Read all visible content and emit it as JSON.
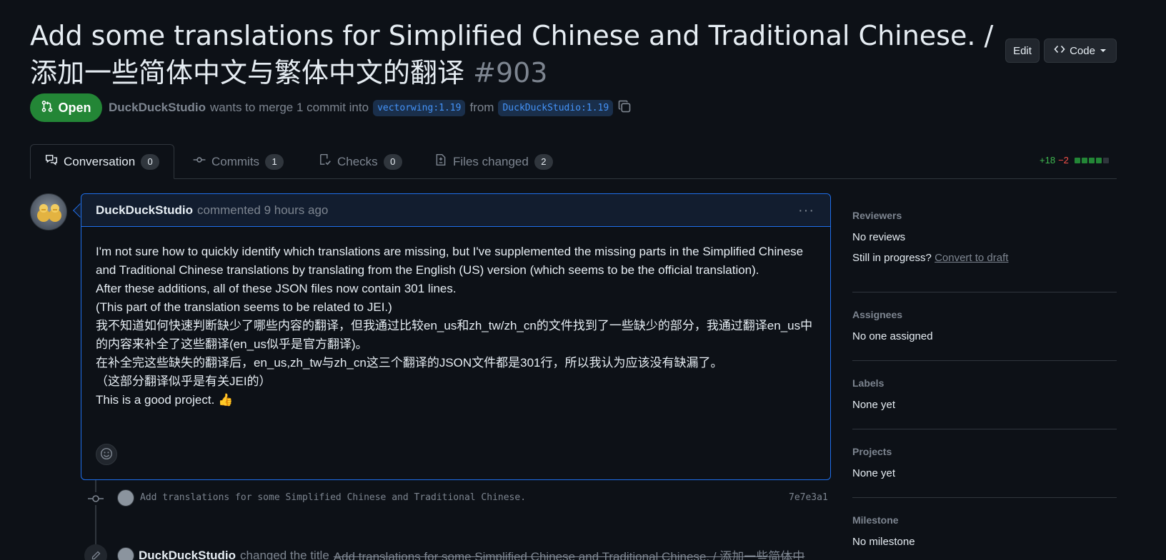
{
  "header": {
    "title": "Add some translations for Simplified Chinese and Traditional Chinese. / 添加一些简体中文与繁体中文的翻译",
    "number": "#903",
    "edit_label": "Edit",
    "code_label": "Code"
  },
  "state": {
    "label": "Open",
    "color": "#238636"
  },
  "meta": {
    "author": "DuckDuckStudio",
    "text": "wants to merge 1 commit into",
    "base_branch": "vectorwing:1.19",
    "from_text": "from",
    "head_branch": "DuckDuckStudio:1.19"
  },
  "tabs": [
    {
      "label": "Conversation",
      "count": "0"
    },
    {
      "label": "Commits",
      "count": "1"
    },
    {
      "label": "Checks",
      "count": "0"
    },
    {
      "label": "Files changed",
      "count": "2"
    }
  ],
  "diffstat": {
    "additions": "+18",
    "deletions": "−2"
  },
  "comment": {
    "author": "DuckDuckStudio",
    "action": "commented 9 hours ago",
    "lines": [
      "I'm not sure how to quickly identify which translations are missing, but I've supplemented the missing parts in the Simplified Chinese and Traditional Chinese translations by translating from the English (US) version (which seems to be the official translation).",
      "After these additions, all of these JSON files now contain 301 lines.",
      "(This part of the translation seems to be related to JEI.)",
      "我不知道如何快速判断缺少了哪些内容的翻译，但我通过比较en_us和zh_tw/zh_cn的文件找到了一些缺少的部分，我通过翻译en_us中的内容来补全了这些翻译(en_us似乎是官方翻译)。",
      "在补全完这些缺失的翻译后，en_us,zh_tw与zh_cn这三个翻译的JSON文件都是301行，所以我认为应该没有缺漏了。",
      "（这部分翻译似乎是有关JEI的）",
      "This is a good project. 👍"
    ]
  },
  "commit": {
    "message": "Add translations for some Simplified Chinese and Traditional Chinese.",
    "sha": "7e7e3a1"
  },
  "rename_event": {
    "author": "DuckDuckStudio",
    "action": "changed the title",
    "old_title": "Add translations for some Simplified Chinese and Traditional Chinese. / 添加一些简体中"
  },
  "sidebar": {
    "reviewers": {
      "label": "Reviewers",
      "value": "No reviews",
      "progress_text": "Still in progress?",
      "convert_link": "Convert to draft"
    },
    "assignees": {
      "label": "Assignees",
      "value": "No one assigned"
    },
    "labels": {
      "label": "Labels",
      "value": "None yet"
    },
    "projects": {
      "label": "Projects",
      "value": "None yet"
    },
    "milestone": {
      "label": "Milestone",
      "value": "No milestone"
    }
  },
  "colors": {
    "background": "#0d1117",
    "accent_blue": "#1f6feb",
    "success_green": "#238636",
    "danger_red": "#f85149",
    "muted_text": "#7d8590"
  },
  "icons": {
    "code": "code-icon",
    "state": "git-pull-request-icon",
    "copy": "copy-icon",
    "conversation": "comment-discussion-icon",
    "commits": "git-commit-icon",
    "checks": "checklist-icon",
    "files": "file-diff-icon",
    "more": "kebab-horizontal-icon",
    "reaction": "smiley-icon",
    "edit": "pencil-icon"
  }
}
